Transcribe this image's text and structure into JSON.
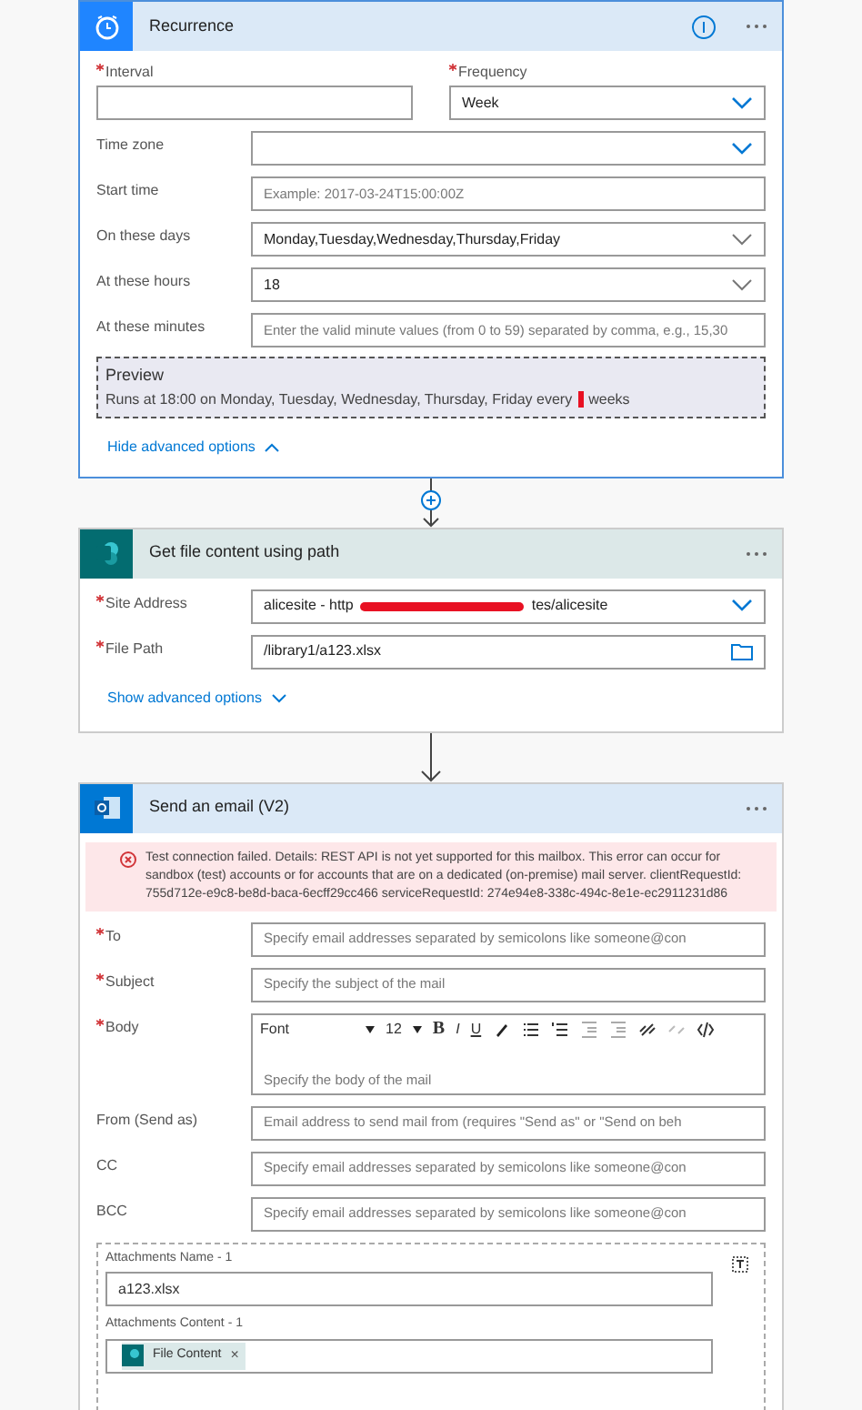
{
  "recurrence": {
    "title": "Recurrence",
    "top_fields": [
      {
        "label": "Interval",
        "required": true,
        "kind": "text"
      },
      {
        "label": "Frequency",
        "required": true,
        "kind": "dropdown",
        "value": "Week"
      }
    ],
    "fields": [
      {
        "label": "Time zone",
        "required": false,
        "kind": "dropdown"
      },
      {
        "label": "Start time",
        "required": false,
        "kind": "text",
        "placeholder": "Example: 2017-03-24T15:00:00Z"
      },
      {
        "label": "On these days",
        "required": false,
        "kind": "dropdown",
        "value": "Monday,Tuesday,Wednesday,Thursday,Friday"
      },
      {
        "label": "At these hours",
        "required": false,
        "kind": "dropdown",
        "value": "18"
      },
      {
        "label": "At these minutes",
        "required": false,
        "kind": "text",
        "placeholder": "Enter the valid minute values (from 0 to 59) separated by comma, e.g., 15,30"
      }
    ],
    "preview": {
      "title": "Preview",
      "text_before": "Runs at 18:00 on Monday, Tuesday, Wednesday, Thursday, Friday every",
      "text_after": "weeks"
    },
    "advanced_link": {
      "label": "Hide advanced options",
      "expanded": true
    }
  },
  "get_file": {
    "title": "Get file content using path",
    "fields": [
      {
        "label": "Site Address",
        "required": true,
        "kind": "dropdown",
        "value": "alicesite - http",
        "value_after_redaction": "tes/alicesite"
      },
      {
        "label": "File Path",
        "required": true,
        "kind": "folder",
        "value": "/library1/a123.xlsx"
      }
    ],
    "advanced_link": {
      "label": "Show advanced options",
      "expanded": false
    }
  },
  "send_email": {
    "title": "Send an email (V2)",
    "error": "Test connection failed. Details: REST API is not yet supported for this mailbox. This error can occur for sandbox (test) accounts or for accounts that are on a dedicated (on-premise) mail server. clientRequestId: 755d712e-e9c8-be8d-baca-6ecff29cc466 serviceRequestId: 274e94e8-338c-494c-8e1e-ec2911231d86",
    "fields": [
      {
        "label": "To",
        "required": true,
        "kind": "text",
        "placeholder": "Specify email addresses separated by semicolons like someone@con"
      },
      {
        "label": "Subject",
        "required": true,
        "kind": "text",
        "placeholder": "Specify the subject of the mail"
      },
      {
        "label": "Body",
        "required": true,
        "kind": "rich",
        "placeholder": "Specify the body of the mail"
      },
      {
        "label": "From (Send as)",
        "required": false,
        "kind": "text",
        "placeholder": "Email address to send mail from (requires \"Send as\" or \"Send on beh"
      },
      {
        "label": "CC",
        "required": false,
        "kind": "text",
        "placeholder": "Specify email addresses separated by semicolons like someone@con"
      },
      {
        "label": "BCC",
        "required": false,
        "kind": "text",
        "placeholder": "Specify email addresses separated by semicolons like someone@con"
      }
    ],
    "toolbar": {
      "font": "Font",
      "size": "12",
      "bold": "B",
      "italic": "I",
      "underline": "U"
    },
    "attachments": {
      "name_label": "Attachments Name - 1",
      "name_value": "a123.xlsx",
      "content_label": "Attachments Content - 1",
      "content_token": "File Content",
      "token_remove": "×"
    }
  }
}
